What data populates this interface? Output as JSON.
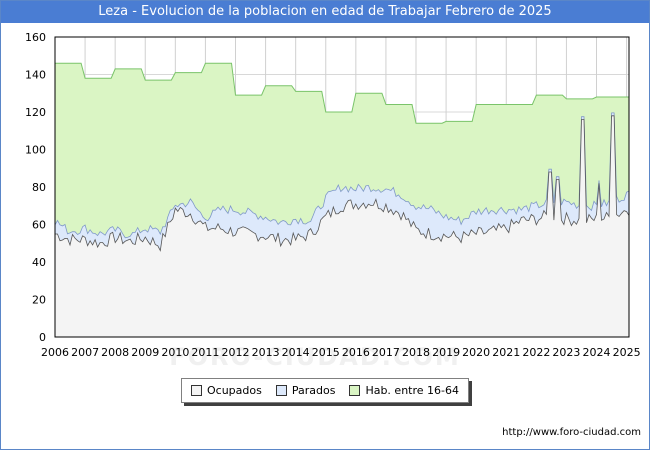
{
  "header": {
    "title": "Leza - Evolucion de la poblacion en edad de Trabajar Febrero de 2025"
  },
  "source": "http://www.foro-ciudad.com",
  "watermark": "FORO-CIUDAD.COM",
  "colors": {
    "ocupados": "#f4f4f4",
    "parados": "#dde9fb",
    "habitantes": "#daf5c4",
    "ocupados_line": "#555555",
    "parados_line": "#7f98c8",
    "habitantes_line": "#7ac46a"
  },
  "chart_data": {
    "type": "area",
    "xlabel": "",
    "ylabel": "",
    "xlim": [
      2006,
      2025.08
    ],
    "ylim": [
      0,
      160
    ],
    "yticks": [
      0,
      20,
      40,
      60,
      80,
      100,
      120,
      140,
      160
    ],
    "xticks": [
      "2006",
      "2007",
      "2008",
      "2009",
      "2010",
      "2011",
      "2012",
      "2013",
      "2014",
      "2015",
      "2016",
      "2017",
      "2018",
      "2019",
      "2020",
      "2021",
      "2022",
      "2023",
      "2024",
      "2025"
    ],
    "grid": true,
    "legend_position": "bottom",
    "series": [
      {
        "name": "Hab. entre 16-64",
        "kind": "annual-step",
        "x": [
          2006,
          2007,
          2008,
          2009,
          2010,
          2011,
          2012,
          2013,
          2014,
          2015,
          2016,
          2017,
          2018,
          2019,
          2020,
          2021,
          2022,
          2023,
          2024
        ],
        "values": [
          146,
          138,
          143,
          137,
          141,
          146,
          129,
          134,
          131,
          120,
          130,
          124,
          114,
          115,
          124,
          124,
          129,
          127,
          128
        ]
      },
      {
        "name": "Parados",
        "kind": "monthly-total",
        "anchors_x": [
          2006,
          2006.5,
          2007,
          2007.5,
          2008,
          2008.5,
          2009,
          2009.5,
          2010,
          2010.5,
          2011,
          2011.5,
          2012,
          2012.5,
          2013,
          2013.5,
          2014,
          2014.5,
          2015,
          2015.5,
          2016,
          2016.5,
          2017,
          2017.5,
          2018,
          2018.5,
          2019,
          2019.5,
          2020,
          2020.5,
          2021,
          2021.5,
          2022,
          2022.5,
          2023,
          2023.5,
          2024,
          2024.5,
          2025
        ],
        "anchors_y": [
          62,
          56,
          58,
          55,
          57,
          54,
          58,
          56,
          70,
          72,
          63,
          68,
          68,
          66,
          64,
          61,
          63,
          62,
          74,
          80,
          79,
          80,
          79,
          76,
          70,
          68,
          64,
          62,
          67,
          68,
          68,
          68,
          70,
          72,
          72,
          70,
          70,
          72,
          76
        ]
      },
      {
        "name": "Ocupados",
        "kind": "monthly",
        "anchors_x": [
          2006,
          2006.5,
          2007,
          2007.5,
          2008,
          2008.5,
          2009,
          2009.5,
          2010,
          2010.5,
          2011,
          2011.5,
          2012,
          2012.5,
          2013,
          2013.5,
          2014,
          2014.5,
          2015,
          2015.5,
          2016,
          2016.5,
          2017,
          2017.5,
          2018,
          2018.5,
          2019,
          2019.5,
          2020,
          2020.5,
          2021,
          2021.5,
          2022,
          2022.5,
          2023,
          2023.5,
          2024,
          2024.5,
          2025
        ],
        "anchors_y": [
          55,
          52,
          52,
          50,
          53,
          51,
          53,
          49,
          68,
          66,
          58,
          58,
          56,
          55,
          54,
          52,
          52,
          55,
          64,
          70,
          71,
          72,
          70,
          66,
          57,
          55,
          54,
          53,
          55,
          56,
          58,
          62,
          63,
          65,
          63,
          62,
          63,
          64,
          68
        ],
        "spikes": [
          [
            2022.45,
            88
          ],
          [
            2022.7,
            84
          ],
          [
            2023.55,
            116
          ],
          [
            2024.55,
            118
          ],
          [
            2024.1,
            82
          ]
        ]
      }
    ]
  }
}
